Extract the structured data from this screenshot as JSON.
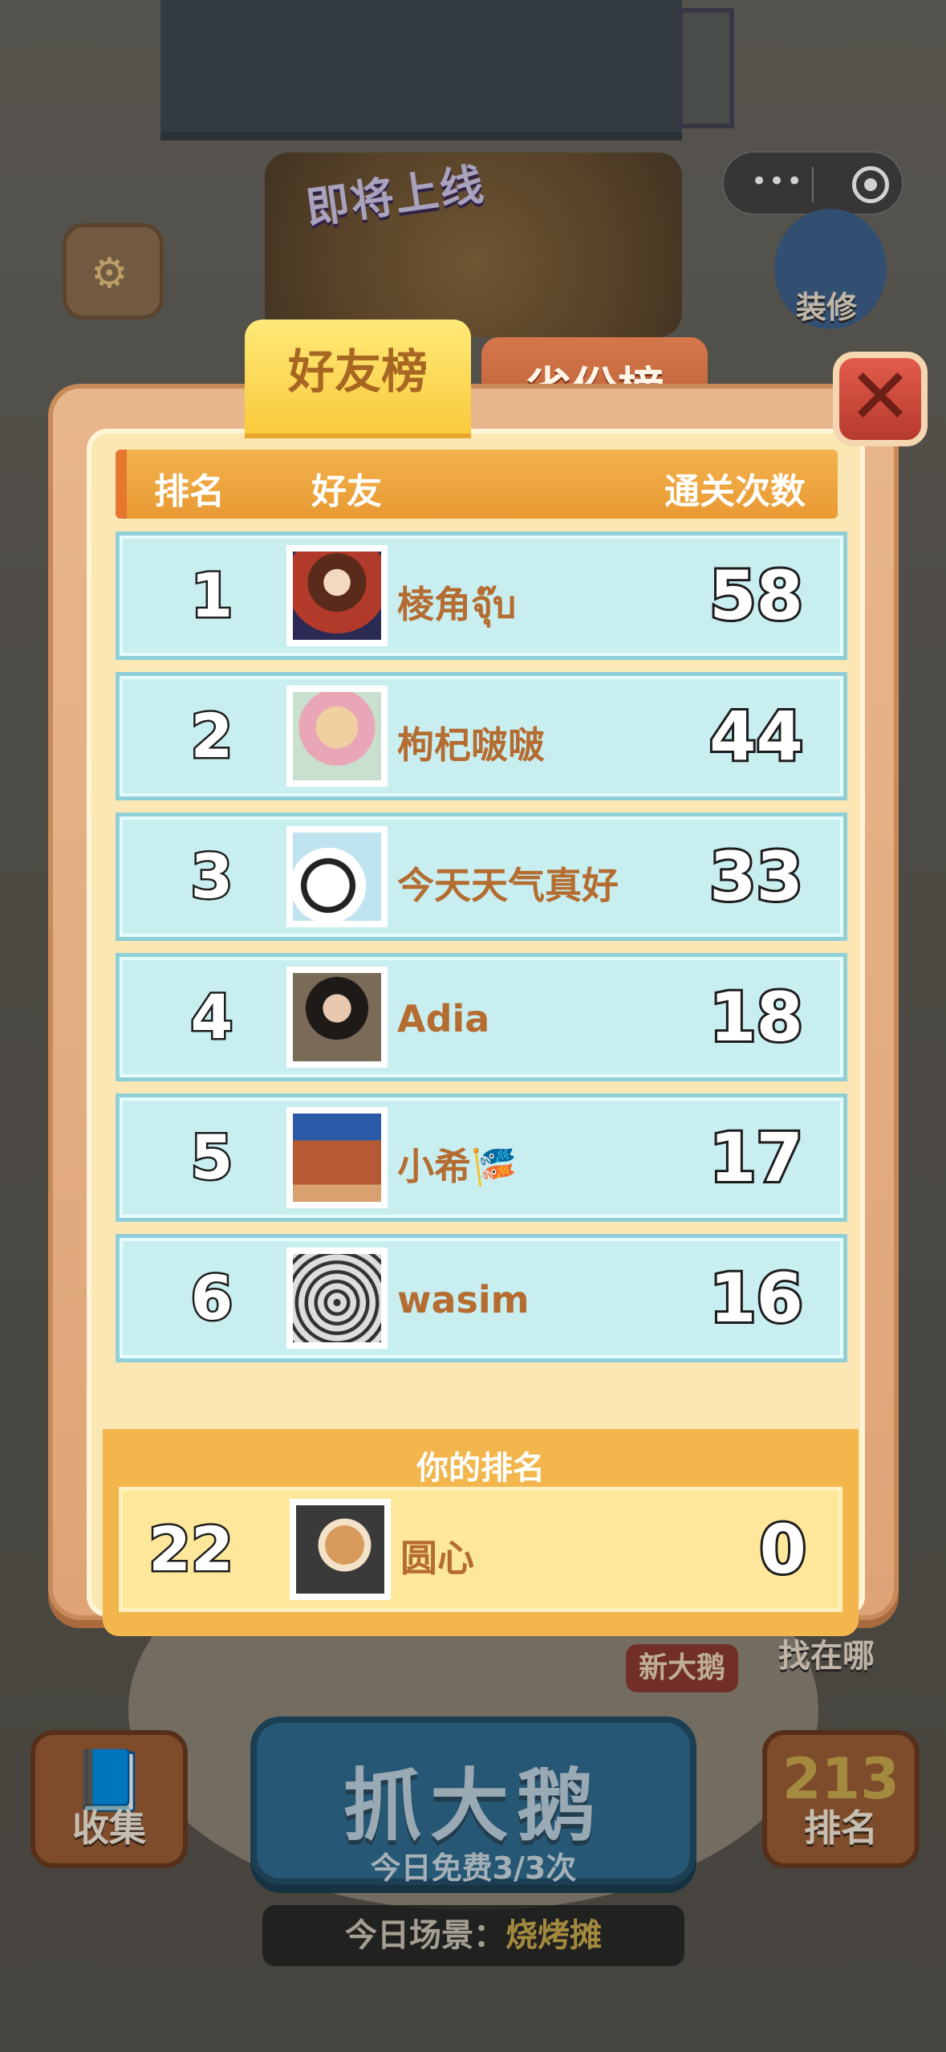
{
  "background": {
    "banner_text": "即将上线",
    "decorate_label": "装修",
    "collect_label": "收集",
    "rank_label": "排名",
    "catch_title": "抓大鹅",
    "catch_subtitle": "今日免费3/3次",
    "scene_prefix": "今日场景：",
    "scene_name": "烧烤摊",
    "new_goose_label": "新大鹅",
    "where_label": "找在哪"
  },
  "tabs": [
    {
      "label": "好友榜",
      "active": true
    },
    {
      "label": "省份榜",
      "active": false
    }
  ],
  "table_header": {
    "rank": "排名",
    "friend": "好友",
    "count": "通关次数"
  },
  "rows": [
    {
      "rank": "1",
      "name": "棱角จุ๊บ",
      "score": "58"
    },
    {
      "rank": "2",
      "name": "枸杞啵啵",
      "score": "44"
    },
    {
      "rank": "3",
      "name": "今天天气真好",
      "score": "33"
    },
    {
      "rank": "4",
      "name": "Adia",
      "score": "18"
    },
    {
      "rank": "5",
      "name": "小希🎏",
      "score": "17"
    },
    {
      "rank": "6",
      "name": "wasim",
      "score": "16"
    }
  ],
  "my_rank": {
    "title": "你的排名",
    "rank": "22",
    "name": "圆心",
    "score": "0"
  },
  "colors": {
    "row_bg": "#c8eef0",
    "accent_orange": "#e99a33",
    "name_color": "#b46c30"
  }
}
